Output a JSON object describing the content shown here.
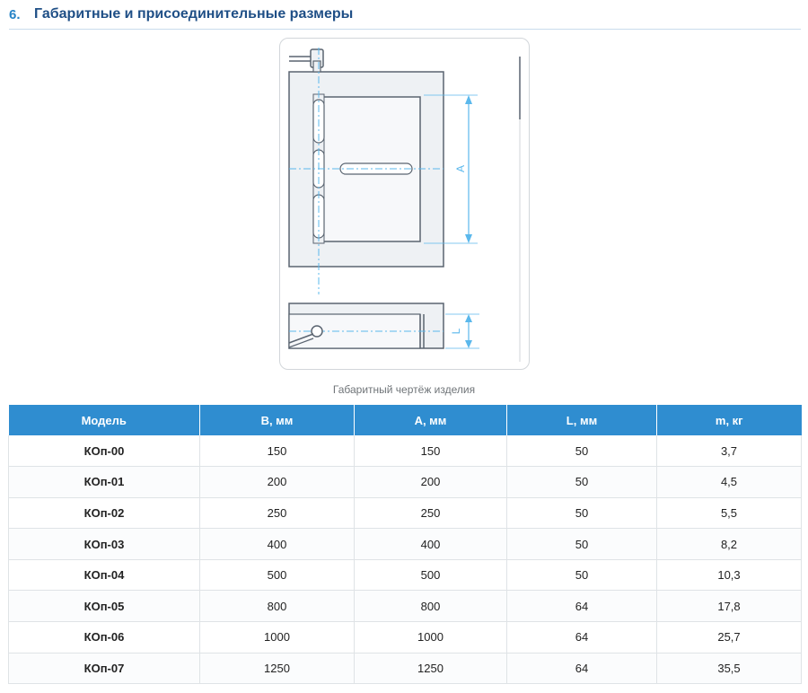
{
  "section": {
    "number": "6.",
    "title": "Габаритные и присоединительные размеры"
  },
  "drawing": {
    "label_a": "A",
    "label_l": "L",
    "caption": "Габаритный чертёж изделия"
  },
  "colors": {
    "accent": "#2f8dd0",
    "title": "#1f4f86",
    "dimension": "#5bb8ec",
    "drawing_fill": "#eef1f4",
    "drawing_line": "#5a6470"
  },
  "table": {
    "headers": [
      "Модель",
      "B, мм",
      "A, мм",
      "L, мм",
      "m, кг"
    ],
    "rows": [
      [
        "КОп-00",
        "150",
        "150",
        "50",
        "3,7"
      ],
      [
        "КОп-01",
        "200",
        "200",
        "50",
        "4,5"
      ],
      [
        "КОп-02",
        "250",
        "250",
        "50",
        "5,5"
      ],
      [
        "КОп-03",
        "400",
        "400",
        "50",
        "8,2"
      ],
      [
        "КОп-04",
        "500",
        "500",
        "50",
        "10,3"
      ],
      [
        "КОп-05",
        "800",
        "800",
        "64",
        "17,8"
      ],
      [
        "КОп-06",
        "1000",
        "1000",
        "64",
        "25,7"
      ],
      [
        "КОп-07",
        "1250",
        "1250",
        "64",
        "35,5"
      ]
    ]
  }
}
